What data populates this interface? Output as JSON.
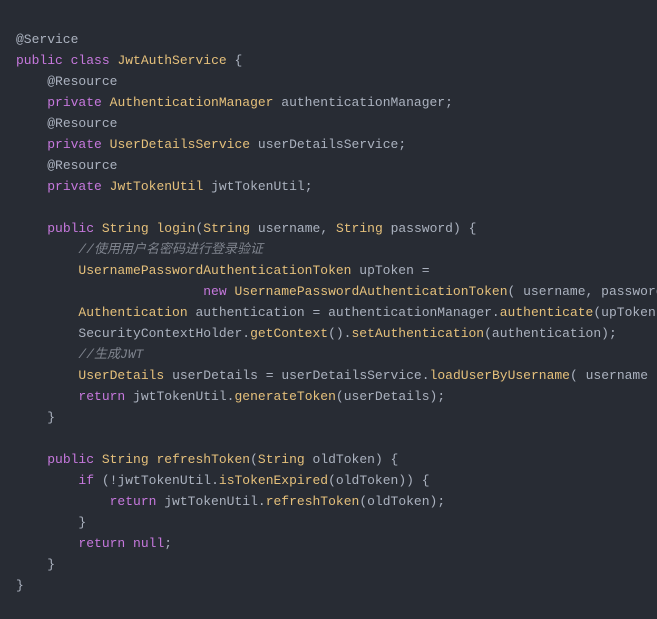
{
  "code": {
    "l1": "@Service",
    "l2_public": "public",
    "l2_class": "class",
    "l2_name": "JwtAuthService",
    "l2_brace": " {",
    "l3": "@Resource",
    "l4_private": "private",
    "l4_type": "AuthenticationManager",
    "l4_name": "authenticationManager",
    "l5": "@Resource",
    "l6_private": "private",
    "l6_type": "UserDetailsService",
    "l6_name": "userDetailsService",
    "l7": "@Resource",
    "l8_private": "private",
    "l8_type": "JwtTokenUtil",
    "l8_name": "jwtTokenUtil",
    "l10_public": "public",
    "l10_ret": "String",
    "l10_method": "login",
    "l10_p1t": "String",
    "l10_p1n": "username",
    "l10_p2t": "String",
    "l10_p2n": "password",
    "l11_comment": "//使用用户名密码进行登录验证",
    "l12_type": "UsernamePasswordAuthenticationToken",
    "l12_var": "upToken",
    "l13_new": "new",
    "l13_ctor": "UsernamePasswordAuthenticationToken",
    "l13_a1": "username",
    "l13_a2": "password",
    "l14_type": "Authentication",
    "l14_var": "authentication",
    "l14_obj": "authenticationManager",
    "l14_call": "authenticate",
    "l14_arg": "upToken",
    "l15_obj": "SecurityContextHolder",
    "l15_c1": "getContext",
    "l15_c2": "setAuthentication",
    "l15_arg": "authentication",
    "l16_comment": "//生成JWT",
    "l17_type": "UserDetails",
    "l17_var": "userDetails",
    "l17_obj": "userDetailsService",
    "l17_call": "loadUserByUsername",
    "l17_arg": "username",
    "l18_return": "return",
    "l18_obj": "jwtTokenUtil",
    "l18_call": "generateToken",
    "l18_arg": "userDetails",
    "l21_public": "public",
    "l21_ret": "String",
    "l21_method": "refreshToken",
    "l21_p1t": "String",
    "l21_p1n": "oldToken",
    "l22_if": "if",
    "l22_obj": "jwtTokenUtil",
    "l22_call": "isTokenExpired",
    "l22_arg": "oldToken",
    "l23_return": "return",
    "l23_obj": "jwtTokenUtil",
    "l23_call": "refreshToken",
    "l23_arg": "oldToken",
    "l25_return": "return",
    "l25_null": "null"
  }
}
